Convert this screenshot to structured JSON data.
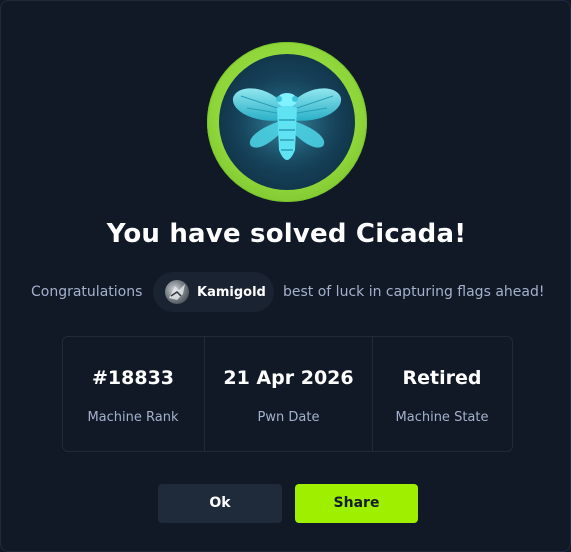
{
  "dialog": {
    "badge_icon": "cicada-icon",
    "title": "You have solved Cicada!",
    "congrats_prefix": "Congratulations",
    "username": "Kamigold",
    "congrats_suffix": "best of luck in capturing flags ahead!"
  },
  "stats": [
    {
      "value": "#18833",
      "label": "Machine Rank"
    },
    {
      "value": "21 Apr 2026",
      "label": "Pwn Date"
    },
    {
      "value": "Retired",
      "label": "Machine State"
    }
  ],
  "buttons": {
    "ok_label": "Ok",
    "share_label": "Share"
  },
  "colors": {
    "background": "#111927",
    "accent_green": "#9fef00",
    "muted_text": "#a4b1cd",
    "panel": "#1f2a3b"
  }
}
